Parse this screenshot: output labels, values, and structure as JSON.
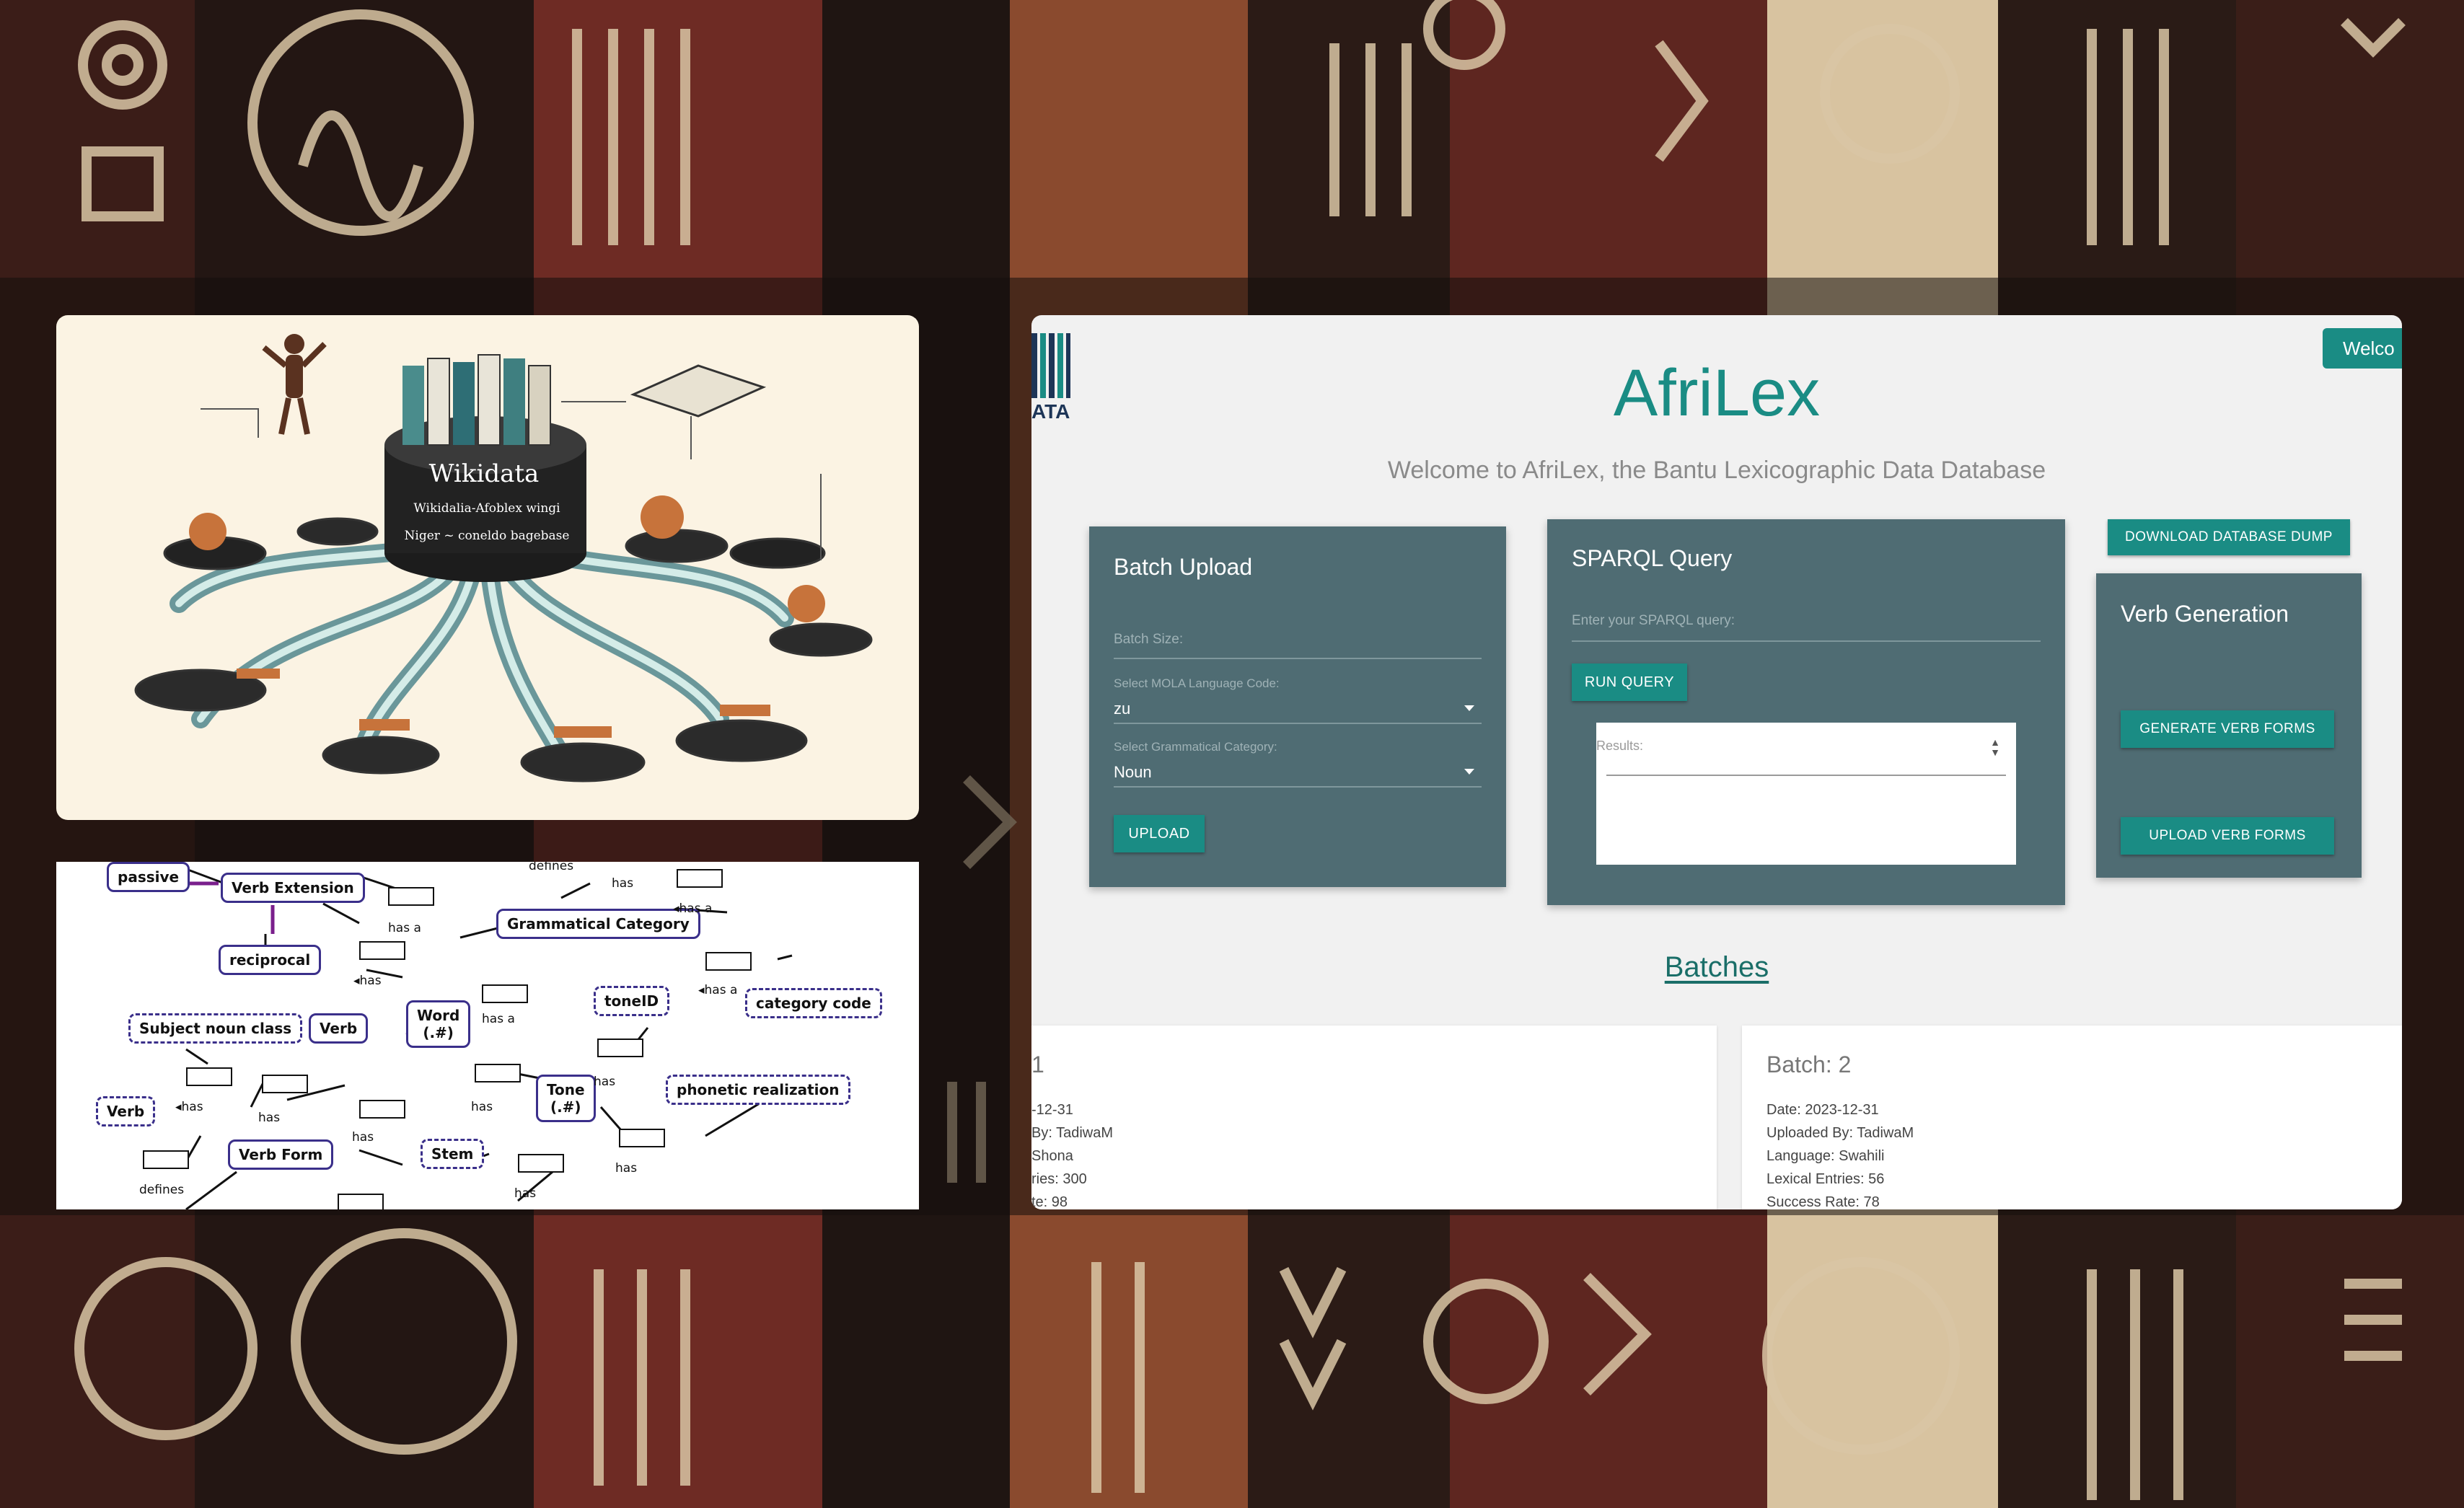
{
  "colors": {
    "accent": "#1a8c84",
    "card": "#4f6c73",
    "app_bg": "#f1f1f1",
    "diagram_border": "#3a2f8a"
  },
  "wikidata_illustration": {
    "center_label": "Wikidata",
    "ribbon_1": "Wikidalia-Afoblex wingi",
    "ribbon_2": "Niger ~ coneldo bagebase"
  },
  "diagram": {
    "nodes": [
      {
        "id": "passive",
        "label": "passive"
      },
      {
        "id": "verb-extension",
        "label": "Verb Extension"
      },
      {
        "id": "reciprocal",
        "label": "reciprocal"
      },
      {
        "id": "grammatical-category",
        "label": "Grammatical Category"
      },
      {
        "id": "toneid",
        "label": "toneID"
      },
      {
        "id": "category-code",
        "label": "category code"
      },
      {
        "id": "subject-noun-class",
        "label": "Subject noun class"
      },
      {
        "id": "verb",
        "label": "Verb"
      },
      {
        "id": "word",
        "label": "Word\n(.#)"
      },
      {
        "id": "tone",
        "label": "Tone\n(.#)"
      },
      {
        "id": "phonetic-realization",
        "label": "phonetic realization"
      },
      {
        "id": "verb-small",
        "label": "Verb"
      },
      {
        "id": "verb-form",
        "label": "Verb Form"
      },
      {
        "id": "stem",
        "label": "Stem"
      }
    ],
    "edge_labels": {
      "defines_top": "defines",
      "has": "has",
      "has_a": "has a",
      "has_left_a": "◂has a",
      "has_left": "◂has",
      "defines_bottom": "defines"
    }
  },
  "app": {
    "logo_text": "ATA",
    "welcome_button": "Welco",
    "title": "AfriLex",
    "subtitle": "Welcome to AfriLex, the Bantu Lexicographic Data Database",
    "batch_upload": {
      "title": "Batch Upload",
      "batch_size_placeholder": "Batch Size:",
      "language_label": "Select MOLA Language Code:",
      "language_value": "zu",
      "category_label": "Select Grammatical Category:",
      "category_value": "Noun",
      "upload_button": "UPLOAD"
    },
    "sparql": {
      "title": "SPARQL Query",
      "query_placeholder": "Enter your SPARQL query:",
      "run_button": "RUN QUERY",
      "results_label": "Results:"
    },
    "download_button": "DOWNLOAD DATABASE DUMP",
    "verb_generation": {
      "title": "Verb Generation",
      "generate_button": "GENERATE VERB FORMS",
      "upload_button": "UPLOAD VERB FORMS"
    },
    "batches_heading": "Batches",
    "batches": [
      {
        "title": "1",
        "date": "-12-31",
        "uploaded_by": "By: TadiwaM",
        "language": "Shona",
        "entries": "ries: 300",
        "success": "te: 98"
      },
      {
        "title": "Batch: 2",
        "date": "Date: 2023-12-31",
        "uploaded_by": "Uploaded By: TadiwaM",
        "language": "Language: Swahili",
        "entries": "Lexical Entries: 56",
        "success": "Success Rate: 78"
      }
    ]
  }
}
